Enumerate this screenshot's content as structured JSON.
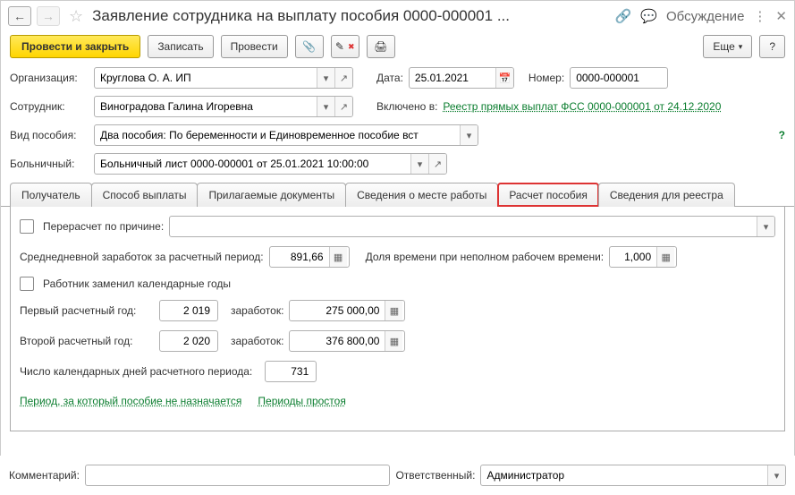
{
  "title": "Заявление сотрудника на выплату пособия 0000-000001 ...",
  "discussion": "Обсуждение",
  "toolbar": {
    "post_close": "Провести и закрыть",
    "save": "Записать",
    "post": "Провести",
    "more": "Еще",
    "help": "?"
  },
  "labels": {
    "org": "Организация:",
    "date": "Дата:",
    "number": "Номер:",
    "employee": "Сотрудник:",
    "included_in": "Включено в:",
    "benefit_type": "Вид пособия:",
    "sick_leave": "Больничный:",
    "comment": "Комментарий:",
    "responsible": "Ответственный:"
  },
  "values": {
    "org": "Круглова О. А. ИП",
    "date": "25.01.2021",
    "number": "0000-000001",
    "employee": "Виноградова Галина Игоревна",
    "registry_link": "Реестр прямых выплат ФСС 0000-000001 от 24.12.2020",
    "benefit_type": "Два пособия: По беременности и Единовременное пособие вст",
    "sick_leave": "Больничный лист 0000-000001 от 25.01.2021 10:00:00",
    "responsible": "Администратор",
    "comment": ""
  },
  "tabs": {
    "t1": "Получатель",
    "t2": "Способ выплаты",
    "t3": "Прилагаемые документы",
    "t4": "Сведения о месте работы",
    "t5": "Расчет пособия",
    "t6": "Сведения для реестра"
  },
  "calc": {
    "recalc_reason": "Перерасчет по причине:",
    "avg_daily": "Среднедневной заработок за расчетный период:",
    "avg_daily_val": "891,66",
    "part_time": "Доля времени при неполном рабочем времени:",
    "part_time_val": "1,000",
    "replaced_years": "Работник заменил календарные годы",
    "year1_label": "Первый расчетный год:",
    "year1": "2 019",
    "earn_label": "заработок:",
    "earn1": "275 000,00",
    "year2_label": "Второй расчетный год:",
    "year2": "2 020",
    "earn2": "376 800,00",
    "days_label": "Число календарных дней расчетного периода:",
    "days": "731",
    "link1": "Период, за который пособие не назначается",
    "link2": "Периоды простоя"
  }
}
